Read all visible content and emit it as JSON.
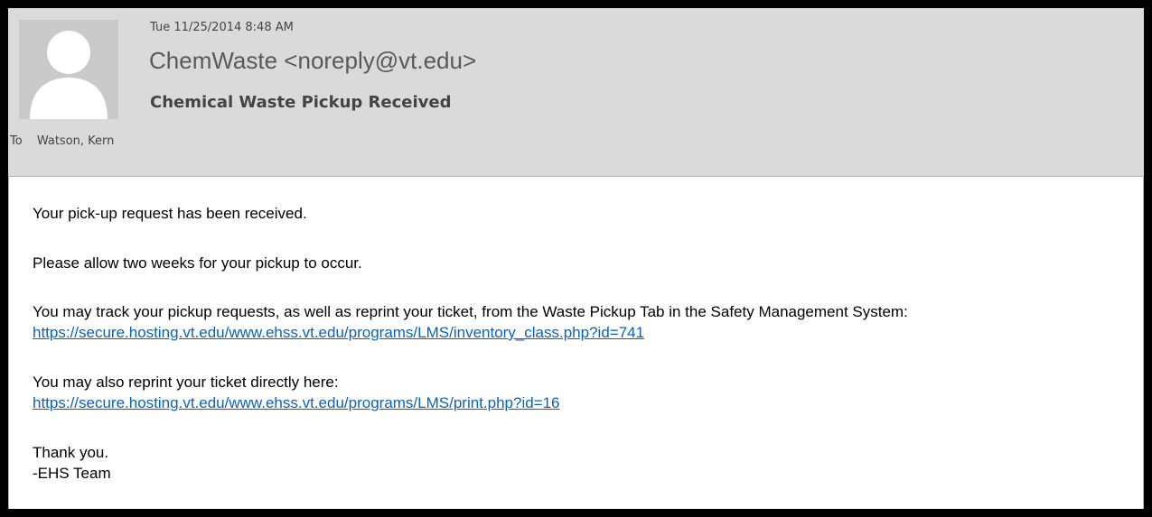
{
  "header": {
    "date": "Tue 11/25/2014 8:48 AM",
    "sender": "ChemWaste <noreply@vt.edu>",
    "subject": "Chemical Waste Pickup Received",
    "to_label": "To",
    "to_name": "Watson, Kern"
  },
  "body": {
    "line1": "Your pick-up request has been received.",
    "line2": "Please allow two weeks for your pickup to occur.",
    "line3": "You may track your pickup requests, as well as reprint your ticket, from the Waste Pickup Tab in the Safety Management System:",
    "link1": "https://secure.hosting.vt.edu/www.ehss.vt.edu/programs/LMS/inventory_class.php?id=741",
    "line4": "You may also reprint your ticket directly here:",
    "link2": "https://secure.hosting.vt.edu/www.ehss.vt.edu/programs/LMS/print.php?id=16",
    "line5": "Thank you.",
    "line6": "-EHS Team"
  },
  "colors": {
    "header_bg": "#dadada",
    "link": "#0563c1",
    "avatar_bg": "#c9c9c9",
    "avatar_figure": "#ffffff"
  }
}
